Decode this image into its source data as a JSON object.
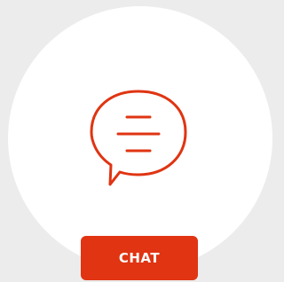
{
  "chat_widget": {
    "icon": "chat-bubble-icon",
    "button_label": "CHAT",
    "accent_color": "#e03412",
    "circle_color": "#ffffff",
    "background_color": "#ececec"
  }
}
